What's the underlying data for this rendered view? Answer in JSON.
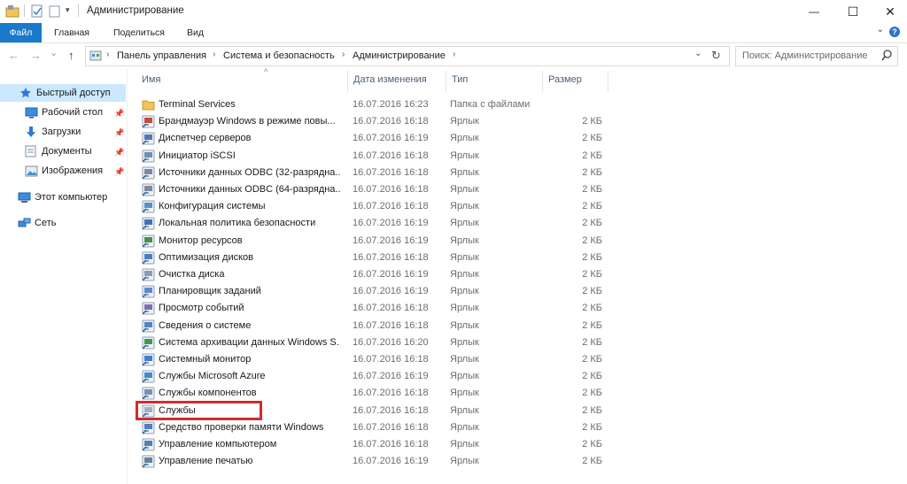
{
  "window": {
    "title": "Администрирование",
    "minimize": "—",
    "maximize": "☐",
    "close": "✕"
  },
  "ribbon": {
    "tabs": [
      "Файл",
      "Главная",
      "Поделиться",
      "Вид"
    ],
    "caret": "⌄",
    "help": "?"
  },
  "nav": {
    "back": "←",
    "forward": "→",
    "dropdown": "⌄",
    "up": "↑"
  },
  "address": {
    "breadcrumb": [
      "Панель управления",
      "Система и безопасность",
      "Администрирование"
    ],
    "refresh": "↻",
    "dropdown": "⌄"
  },
  "search": {
    "placeholder": "Поиск: Администрирование"
  },
  "sidebar": {
    "items": [
      {
        "label": "Быстрый доступ",
        "icon": "star-icon",
        "pinned": false
      },
      {
        "label": "Рабочий стол",
        "icon": "desktop-icon",
        "pinned": true
      },
      {
        "label": "Загрузки",
        "icon": "download-icon",
        "pinned": true
      },
      {
        "label": "Документы",
        "icon": "documents-icon",
        "pinned": true
      },
      {
        "label": "Изображения",
        "icon": "pictures-icon",
        "pinned": true
      },
      {
        "label": "Этот компьютер",
        "icon": "computer-icon",
        "pinned": false
      },
      {
        "label": "Сеть",
        "icon": "network-icon",
        "pinned": false
      }
    ]
  },
  "columns": {
    "name": "Имя",
    "date": "Дата изменения",
    "type": "Тип",
    "size": "Размер",
    "sort_indicator": "^"
  },
  "files": [
    {
      "name": "Terminal Services",
      "date": "16.07.2016 16:23",
      "type": "Папка с файлами",
      "size": "",
      "icon": "folder-icon"
    },
    {
      "name": "Брандмауэр Windows в режиме повы...",
      "date": "16.07.2016 16:18",
      "type": "Ярлык",
      "size": "2 КБ",
      "icon": "firewall-icon"
    },
    {
      "name": "Диспетчер серверов",
      "date": "16.07.2016 16:19",
      "type": "Ярлык",
      "size": "2 КБ",
      "icon": "server-manager-icon"
    },
    {
      "name": "Инициатор iSCSI",
      "date": "16.07.2016 16:18",
      "type": "Ярлык",
      "size": "2 КБ",
      "icon": "iscsi-icon"
    },
    {
      "name": "Источники данных ODBC (32-разрядна...",
      "date": "16.07.2016 16:18",
      "type": "Ярлык",
      "size": "2 КБ",
      "icon": "odbc-icon"
    },
    {
      "name": "Источники данных ODBC (64-разрядна...",
      "date": "16.07.2016 16:18",
      "type": "Ярлык",
      "size": "2 КБ",
      "icon": "odbc-icon"
    },
    {
      "name": "Конфигурация системы",
      "date": "16.07.2016 16:18",
      "type": "Ярлык",
      "size": "2 КБ",
      "icon": "msconfig-icon"
    },
    {
      "name": "Локальная политика безопасности",
      "date": "16.07.2016 16:19",
      "type": "Ярлык",
      "size": "2 КБ",
      "icon": "security-policy-icon"
    },
    {
      "name": "Монитор ресурсов",
      "date": "16.07.2016 16:19",
      "type": "Ярлык",
      "size": "2 КБ",
      "icon": "resource-monitor-icon"
    },
    {
      "name": "Оптимизация дисков",
      "date": "16.07.2016 16:18",
      "type": "Ярлык",
      "size": "2 КБ",
      "icon": "defrag-icon"
    },
    {
      "name": "Очистка диска",
      "date": "16.07.2016 16:19",
      "type": "Ярлык",
      "size": "2 КБ",
      "icon": "disk-cleanup-icon"
    },
    {
      "name": "Планировщик заданий",
      "date": "16.07.2016 16:19",
      "type": "Ярлык",
      "size": "2 КБ",
      "icon": "task-scheduler-icon"
    },
    {
      "name": "Просмотр событий",
      "date": "16.07.2016 16:18",
      "type": "Ярлык",
      "size": "2 КБ",
      "icon": "event-viewer-icon"
    },
    {
      "name": "Сведения о системе",
      "date": "16.07.2016 16:18",
      "type": "Ярлык",
      "size": "2 КБ",
      "icon": "system-info-icon"
    },
    {
      "name": "Система архивации данных Windows S...",
      "date": "16.07.2016 16:20",
      "type": "Ярлык",
      "size": "2 КБ",
      "icon": "backup-icon"
    },
    {
      "name": "Системный монитор",
      "date": "16.07.2016 16:18",
      "type": "Ярлык",
      "size": "2 КБ",
      "icon": "performance-monitor-icon"
    },
    {
      "name": "Службы Microsoft Azure",
      "date": "16.07.2016 16:19",
      "type": "Ярлык",
      "size": "2 КБ",
      "icon": "azure-icon"
    },
    {
      "name": "Службы компонентов",
      "date": "16.07.2016 16:18",
      "type": "Ярлык",
      "size": "2 КБ",
      "icon": "component-services-icon"
    },
    {
      "name": "Службы",
      "date": "16.07.2016 16:18",
      "type": "Ярлык",
      "size": "2 КБ",
      "icon": "services-icon"
    },
    {
      "name": "Средство проверки памяти Windows",
      "date": "16.07.2016 16:18",
      "type": "Ярлык",
      "size": "2 КБ",
      "icon": "memory-diagnostic-icon"
    },
    {
      "name": "Управление компьютером",
      "date": "16.07.2016 16:18",
      "type": "Ярлык",
      "size": "2 КБ",
      "icon": "computer-management-icon"
    },
    {
      "name": "Управление печатью",
      "date": "16.07.2016 16:19",
      "type": "Ярлык",
      "size": "2 КБ",
      "icon": "print-management-icon"
    }
  ],
  "colors": {
    "accent": "#1979ca",
    "selection": "#cce8ff",
    "highlight_box": "#d42b2b",
    "folder": "#f0c45a"
  }
}
